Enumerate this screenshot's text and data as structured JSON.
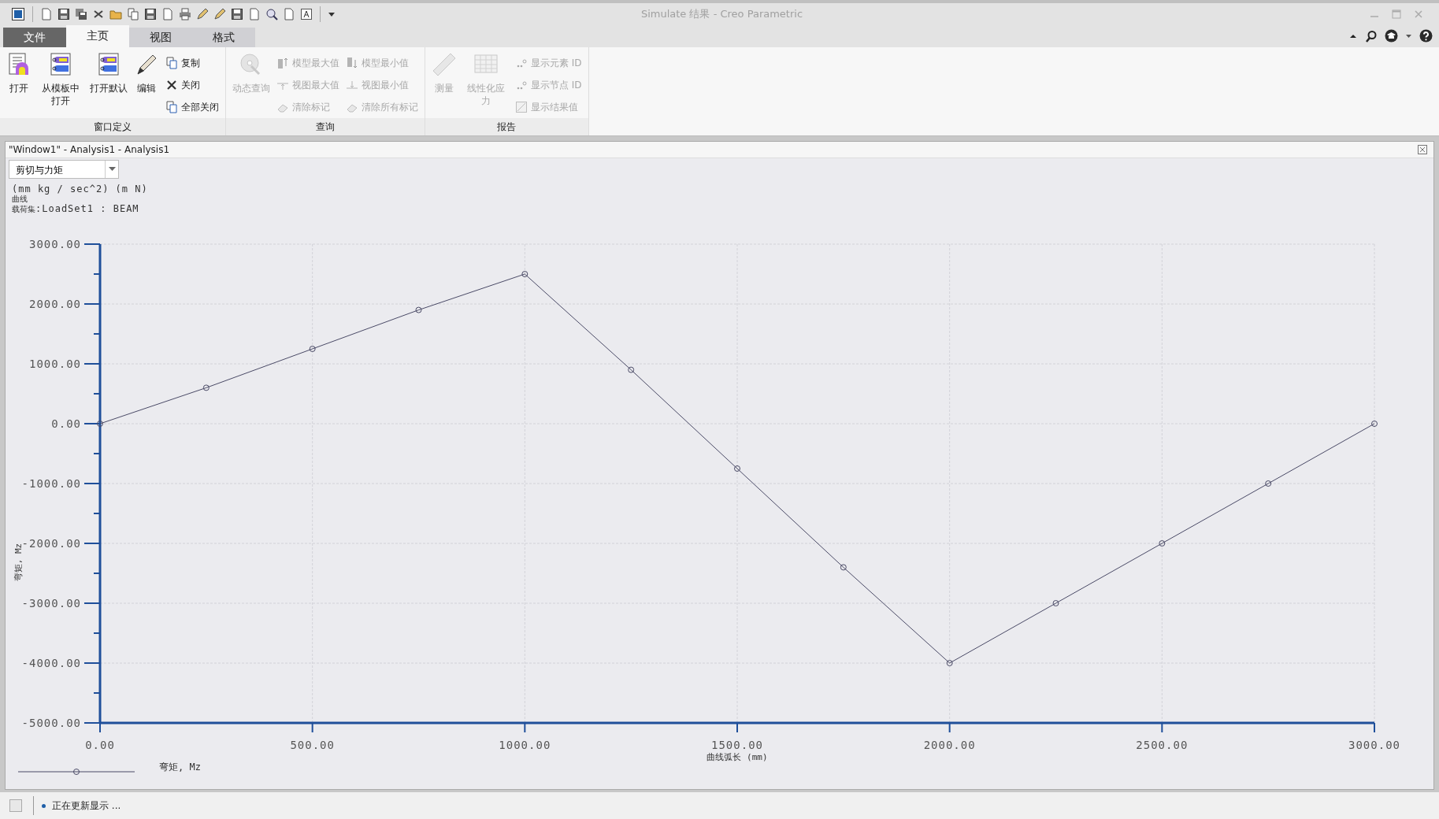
{
  "window": {
    "title": "Simulate 结果 - Creo Parametric"
  },
  "tabs": [
    {
      "label": "文件",
      "kind": "file",
      "selected": false
    },
    {
      "label": "主页",
      "kind": "tab",
      "selected": true
    },
    {
      "label": "视图",
      "kind": "tab",
      "selected": false
    },
    {
      "label": "格式",
      "kind": "tab",
      "selected": false
    }
  ],
  "ribbon": {
    "groups": [
      {
        "label": "窗口定义",
        "large_buttons": [
          {
            "label": "打开",
            "disabled": false
          },
          {
            "label": "从模板中打开",
            "disabled": false
          },
          {
            "label": "打开默认",
            "disabled": false
          },
          {
            "label": "编辑",
            "disabled": false
          }
        ],
        "small_buttons": [
          {
            "label": "复制",
            "disabled": false
          },
          {
            "label": "关闭",
            "disabled": false
          },
          {
            "label": "全部关闭",
            "disabled": false
          }
        ]
      },
      {
        "label": "查询",
        "large_buttons": [
          {
            "label": "动态查询",
            "disabled": true
          }
        ],
        "small_buttons": [
          {
            "label": "模型最大值",
            "disabled": true
          },
          {
            "label": "视图最大值",
            "disabled": true
          },
          {
            "label": "清除标记",
            "disabled": true
          },
          {
            "label": "模型最小值",
            "disabled": true
          },
          {
            "label": "视图最小值",
            "disabled": true
          },
          {
            "label": "清除所有标记",
            "disabled": true
          }
        ]
      },
      {
        "label": "报告",
        "large_buttons": [
          {
            "label": "测量",
            "disabled": true
          },
          {
            "label": "线性化应力",
            "disabled": true
          }
        ],
        "small_buttons": [
          {
            "label": "显示元素 ID",
            "disabled": true
          },
          {
            "label": "显示节点 ID",
            "disabled": true
          },
          {
            "label": "显示结果值",
            "disabled": true
          }
        ]
      }
    ]
  },
  "graph_window": {
    "title": "\"Window1\" - Analysis1 - Analysis1",
    "quantity_dropdown": {
      "value": "剪切与力矩"
    },
    "units": "(mm kg / sec^2)  (m N)",
    "curve_label": "曲线",
    "loadset_label": "载荷集",
    "loadset_value": ":LoadSet1  :  BEAM",
    "chart_data": {
      "type": "line",
      "xlabel": "曲线弧长 (mm)",
      "ylabel": "弯矩, Mz",
      "x": [
        0,
        250,
        500,
        750,
        1000,
        1250,
        1500,
        1750,
        2000,
        2250,
        2500,
        2750,
        3000
      ],
      "series": [
        {
          "name": "弯矩, Mz",
          "color": "#4a4a66",
          "marker": "circle",
          "values": [
            0,
            600,
            1250,
            1900,
            2500,
            900,
            -750,
            -2400,
            -4000,
            -3000,
            -2000,
            -1000,
            0
          ]
        }
      ],
      "grid": true,
      "xlim": [
        0,
        3000
      ],
      "ylim": [
        -5000,
        3000
      ],
      "xticks": [
        {
          "value": 0,
          "label": "0.00"
        },
        {
          "value": 500,
          "label": "500.00"
        },
        {
          "value": 1000,
          "label": "1000.00"
        },
        {
          "value": 1500,
          "label": "1500.00"
        },
        {
          "value": 2000,
          "label": "2000.00"
        },
        {
          "value": 2500,
          "label": "2500.00"
        },
        {
          "value": 3000,
          "label": "3000.00"
        }
      ],
      "yticks": [
        {
          "value": 3000,
          "label": "3000.00"
        },
        {
          "value": 2000,
          "label": "2000.00"
        },
        {
          "value": 1000,
          "label": "1000.00"
        },
        {
          "value": 0,
          "label": "0.00"
        },
        {
          "value": -1000,
          "label": "-1000.00"
        },
        {
          "value": -2000,
          "label": "-2000.00"
        },
        {
          "value": -3000,
          "label": "-3000.00"
        },
        {
          "value": -4000,
          "label": "-4000.00"
        },
        {
          "value": -5000,
          "label": "-5000.00"
        }
      ]
    }
  },
  "status_bar": {
    "message": "正在更新显示 ..."
  }
}
